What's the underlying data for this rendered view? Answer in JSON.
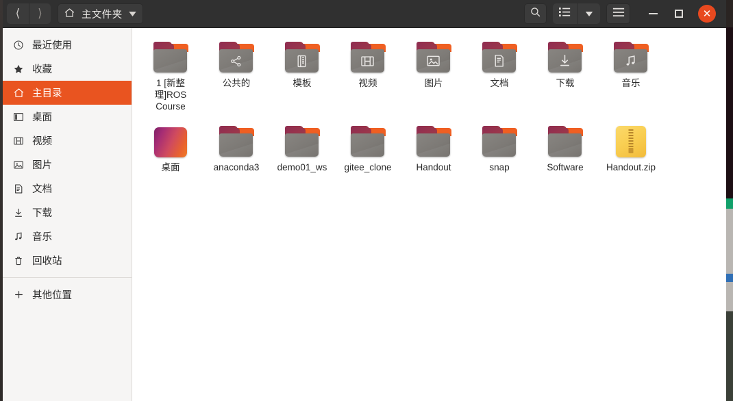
{
  "window": {
    "title": "主文件夹",
    "accent_color": "#e95420",
    "headerbar_color": "#303030",
    "close_button_color": "#e8491f"
  },
  "header": {
    "back_icon": "chevron-left-icon",
    "forward_icon": "chevron-right-icon",
    "path_icon": "home-icon",
    "path_label": "主文件夹",
    "path_dropdown_icon": "chevron-down-icon",
    "search_icon": "search-icon",
    "view_list_icon": "list-view-icon",
    "view_dropdown_icon": "chevron-down-icon",
    "menu_icon": "hamburger-menu-icon",
    "minimize_icon": "minimize-icon",
    "maximize_icon": "maximize-icon",
    "close_icon": "close-icon"
  },
  "sidebar": {
    "items": [
      {
        "label": "最近使用",
        "icon": "clock-icon",
        "selected": false
      },
      {
        "label": "收藏",
        "icon": "star-icon",
        "selected": false
      },
      {
        "label": "主目录",
        "icon": "home-icon",
        "selected": true
      },
      {
        "label": "桌面",
        "icon": "desktop-icon",
        "selected": false
      },
      {
        "label": "视频",
        "icon": "film-icon",
        "selected": false
      },
      {
        "label": "图片",
        "icon": "image-icon",
        "selected": false
      },
      {
        "label": "文档",
        "icon": "document-icon",
        "selected": false
      },
      {
        "label": "下载",
        "icon": "download-icon",
        "selected": false
      },
      {
        "label": "音乐",
        "icon": "music-icon",
        "selected": false
      },
      {
        "label": "回收站",
        "icon": "trash-icon",
        "selected": false
      }
    ],
    "other_locations": {
      "label": "其他位置",
      "icon": "plus-icon"
    }
  },
  "files": [
    {
      "name": "1 [新整理]ROS Course",
      "type": "folder",
      "emblem": "none"
    },
    {
      "name": "公共的",
      "type": "folder",
      "emblem": "share-icon"
    },
    {
      "name": "模板",
      "type": "folder",
      "emblem": "template-icon"
    },
    {
      "name": "视频",
      "type": "folder",
      "emblem": "film-icon"
    },
    {
      "name": "图片",
      "type": "folder",
      "emblem": "image-icon"
    },
    {
      "name": "文档",
      "type": "folder",
      "emblem": "document-icon"
    },
    {
      "name": "下载",
      "type": "folder",
      "emblem": "download-icon"
    },
    {
      "name": "音乐",
      "type": "folder",
      "emblem": "music-icon"
    },
    {
      "name": "桌面",
      "type": "desktop",
      "emblem": "none"
    },
    {
      "name": "anaconda3",
      "type": "folder",
      "emblem": "none"
    },
    {
      "name": "demo01_ws",
      "type": "folder",
      "emblem": "none"
    },
    {
      "name": "gitee_clone",
      "type": "folder",
      "emblem": "none"
    },
    {
      "name": "Handout",
      "type": "folder",
      "emblem": "none"
    },
    {
      "name": "snap",
      "type": "folder",
      "emblem": "none"
    },
    {
      "name": "Software",
      "type": "folder",
      "emblem": "none"
    },
    {
      "name": "Handout.zip",
      "type": "archive",
      "emblem": "zip-icon"
    }
  ]
}
